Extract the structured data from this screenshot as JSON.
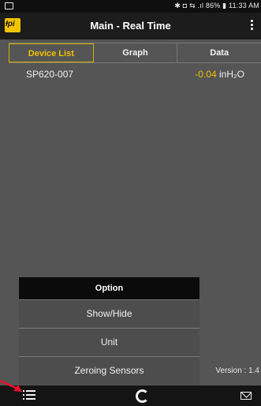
{
  "status_bar": {
    "right_text": "✱ ◘ ⇆ .ıl 86% ▮ 11:33 AM"
  },
  "app_bar": {
    "logo_text": "Ɨpi",
    "title": "Main - Real Time",
    "menu_icon": "more-vert-icon"
  },
  "tabs": [
    {
      "label": "Device List",
      "active": true
    },
    {
      "label": "Graph",
      "active": false
    },
    {
      "label": "Data",
      "active": false
    }
  ],
  "device_list": [
    {
      "name": "SP620-007",
      "value": "-0.04",
      "unit": "inH₂O"
    }
  ],
  "option_menu": {
    "header": "Option",
    "items": [
      "Show/Hide",
      "Unit",
      "Zeroing Sensors"
    ]
  },
  "version_text": "Version : 1.4",
  "bottom_bar": {
    "icons": [
      "list-icon",
      "refresh-icon",
      "mail-icon"
    ]
  },
  "colors": {
    "accent": "#f0c000",
    "annotation": "#e8102a",
    "background": "#555555"
  }
}
